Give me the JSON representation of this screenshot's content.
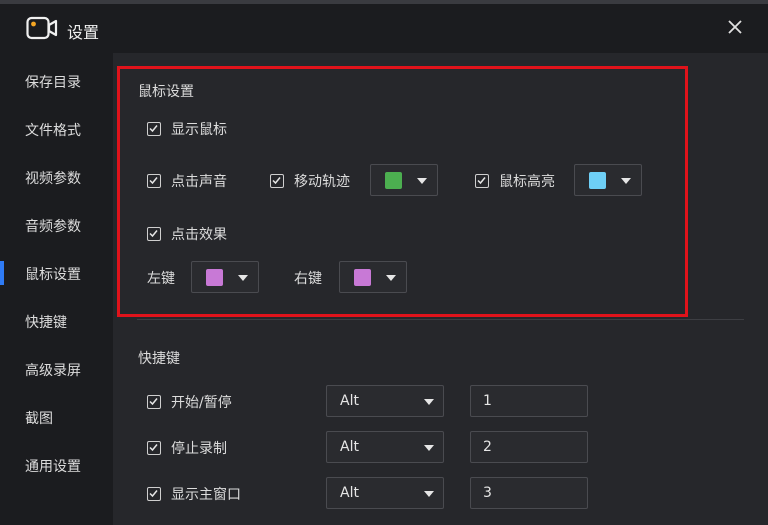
{
  "window": {
    "title": "设置"
  },
  "sidebar": {
    "items": [
      {
        "label": "保存目录"
      },
      {
        "label": "文件格式"
      },
      {
        "label": "视频参数"
      },
      {
        "label": "音频参数"
      },
      {
        "label": "鼠标设置",
        "active": true
      },
      {
        "label": "快捷键"
      },
      {
        "label": "高级录屏"
      },
      {
        "label": "截图"
      },
      {
        "label": "通用设置"
      }
    ]
  },
  "mouse": {
    "title": "鼠标设置",
    "show_cursor": {
      "label": "显示鼠标",
      "checked": true
    },
    "click_sound": {
      "label": "点击声音",
      "checked": true
    },
    "move_trail": {
      "label": "移动轨迹",
      "checked": true,
      "color": "#4caf50"
    },
    "highlight": {
      "label": "鼠标高亮",
      "checked": true,
      "color": "#6ecff6"
    },
    "click_effect": {
      "label": "点击效果",
      "checked": true
    },
    "left_key": {
      "label": "左键",
      "color": "#c879d6"
    },
    "right_key": {
      "label": "右键",
      "color": "#c879d6"
    }
  },
  "shortcuts": {
    "title": "快捷键",
    "rows": [
      {
        "label": "开始/暂停",
        "checked": true,
        "modifier": "Alt",
        "key": "1"
      },
      {
        "label": "停止录制",
        "checked": true,
        "modifier": "Alt",
        "key": "2"
      },
      {
        "label": "显示主窗口",
        "checked": true,
        "modifier": "Alt",
        "key": "3"
      }
    ]
  },
  "colors": {
    "accent": "#2f7bf5",
    "highlight_frame": "#e0131b"
  }
}
